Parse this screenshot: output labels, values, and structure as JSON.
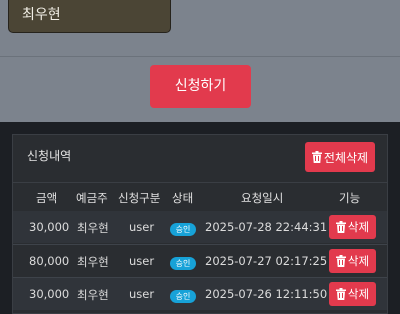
{
  "form": {
    "name_value": "최우현",
    "submit_label": "신청하기"
  },
  "history": {
    "title": "신청내역",
    "delete_all_label": "전체삭제",
    "columns": [
      "금액",
      "예금주",
      "신청구분",
      "상태",
      "요청일시",
      "기능"
    ],
    "rows": [
      {
        "amount": "30,000",
        "holder": "최우현",
        "type": "user",
        "status": "승인",
        "datetime": "2025-07-28 22:44:31",
        "action": "삭제"
      },
      {
        "amount": "80,000",
        "holder": "최우현",
        "type": "user",
        "status": "승인",
        "datetime": "2025-07-27 02:17:25",
        "action": "삭제"
      },
      {
        "amount": "30,000",
        "holder": "최우현",
        "type": "user",
        "status": "승인",
        "datetime": "2025-07-26 12:11:50",
        "action": "삭제"
      }
    ]
  },
  "colors": {
    "accent": "#e23a4d",
    "status_badge": "#17a2d8"
  },
  "icons": {
    "delete": "trash-icon"
  }
}
